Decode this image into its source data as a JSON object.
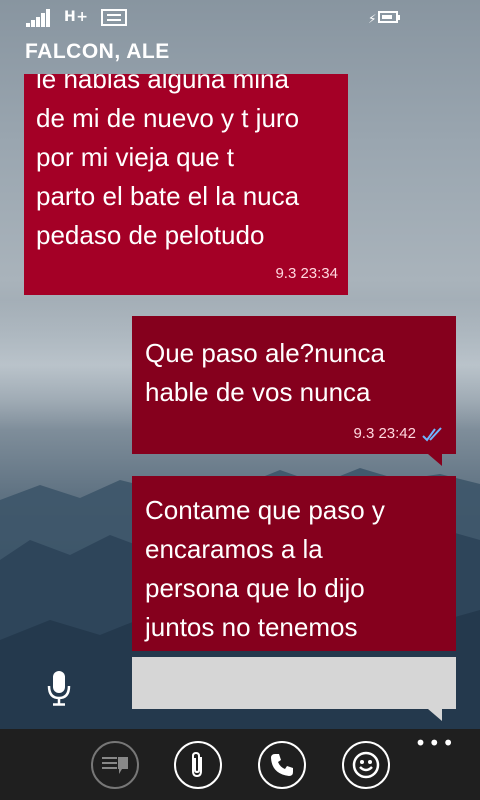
{
  "status_bar": {
    "network": "H+"
  },
  "header": {
    "contact_name": "FALCON, ALE"
  },
  "messages": [
    {
      "direction": "incoming",
      "text": "le hablas alguna mina\nde mi de nuevo y t juro\npor mi vieja que t\nparto el bate el la nuca\npedaso de pelotudo",
      "time": "9.3 23:34"
    },
    {
      "direction": "outgoing",
      "text": "Que paso ale?nunca\nhable de vos nunca",
      "time": "9.3 23:42",
      "status": "read"
    },
    {
      "direction": "outgoing",
      "text": "Contame que paso y\nencaramos a la\npersona que lo dijo\njuntos no tenemos",
      "time": ""
    }
  ],
  "composer": {
    "placeholder": ""
  },
  "app_bar": {
    "buttons": [
      "emoticon-keyboard",
      "attach",
      "call",
      "smiley"
    ]
  },
  "colors": {
    "incoming_bubble": "#a40026",
    "outgoing_bubble": "#85001d",
    "app_bar": "#1f1f1f",
    "read_ticks": "#6fb6ff"
  }
}
